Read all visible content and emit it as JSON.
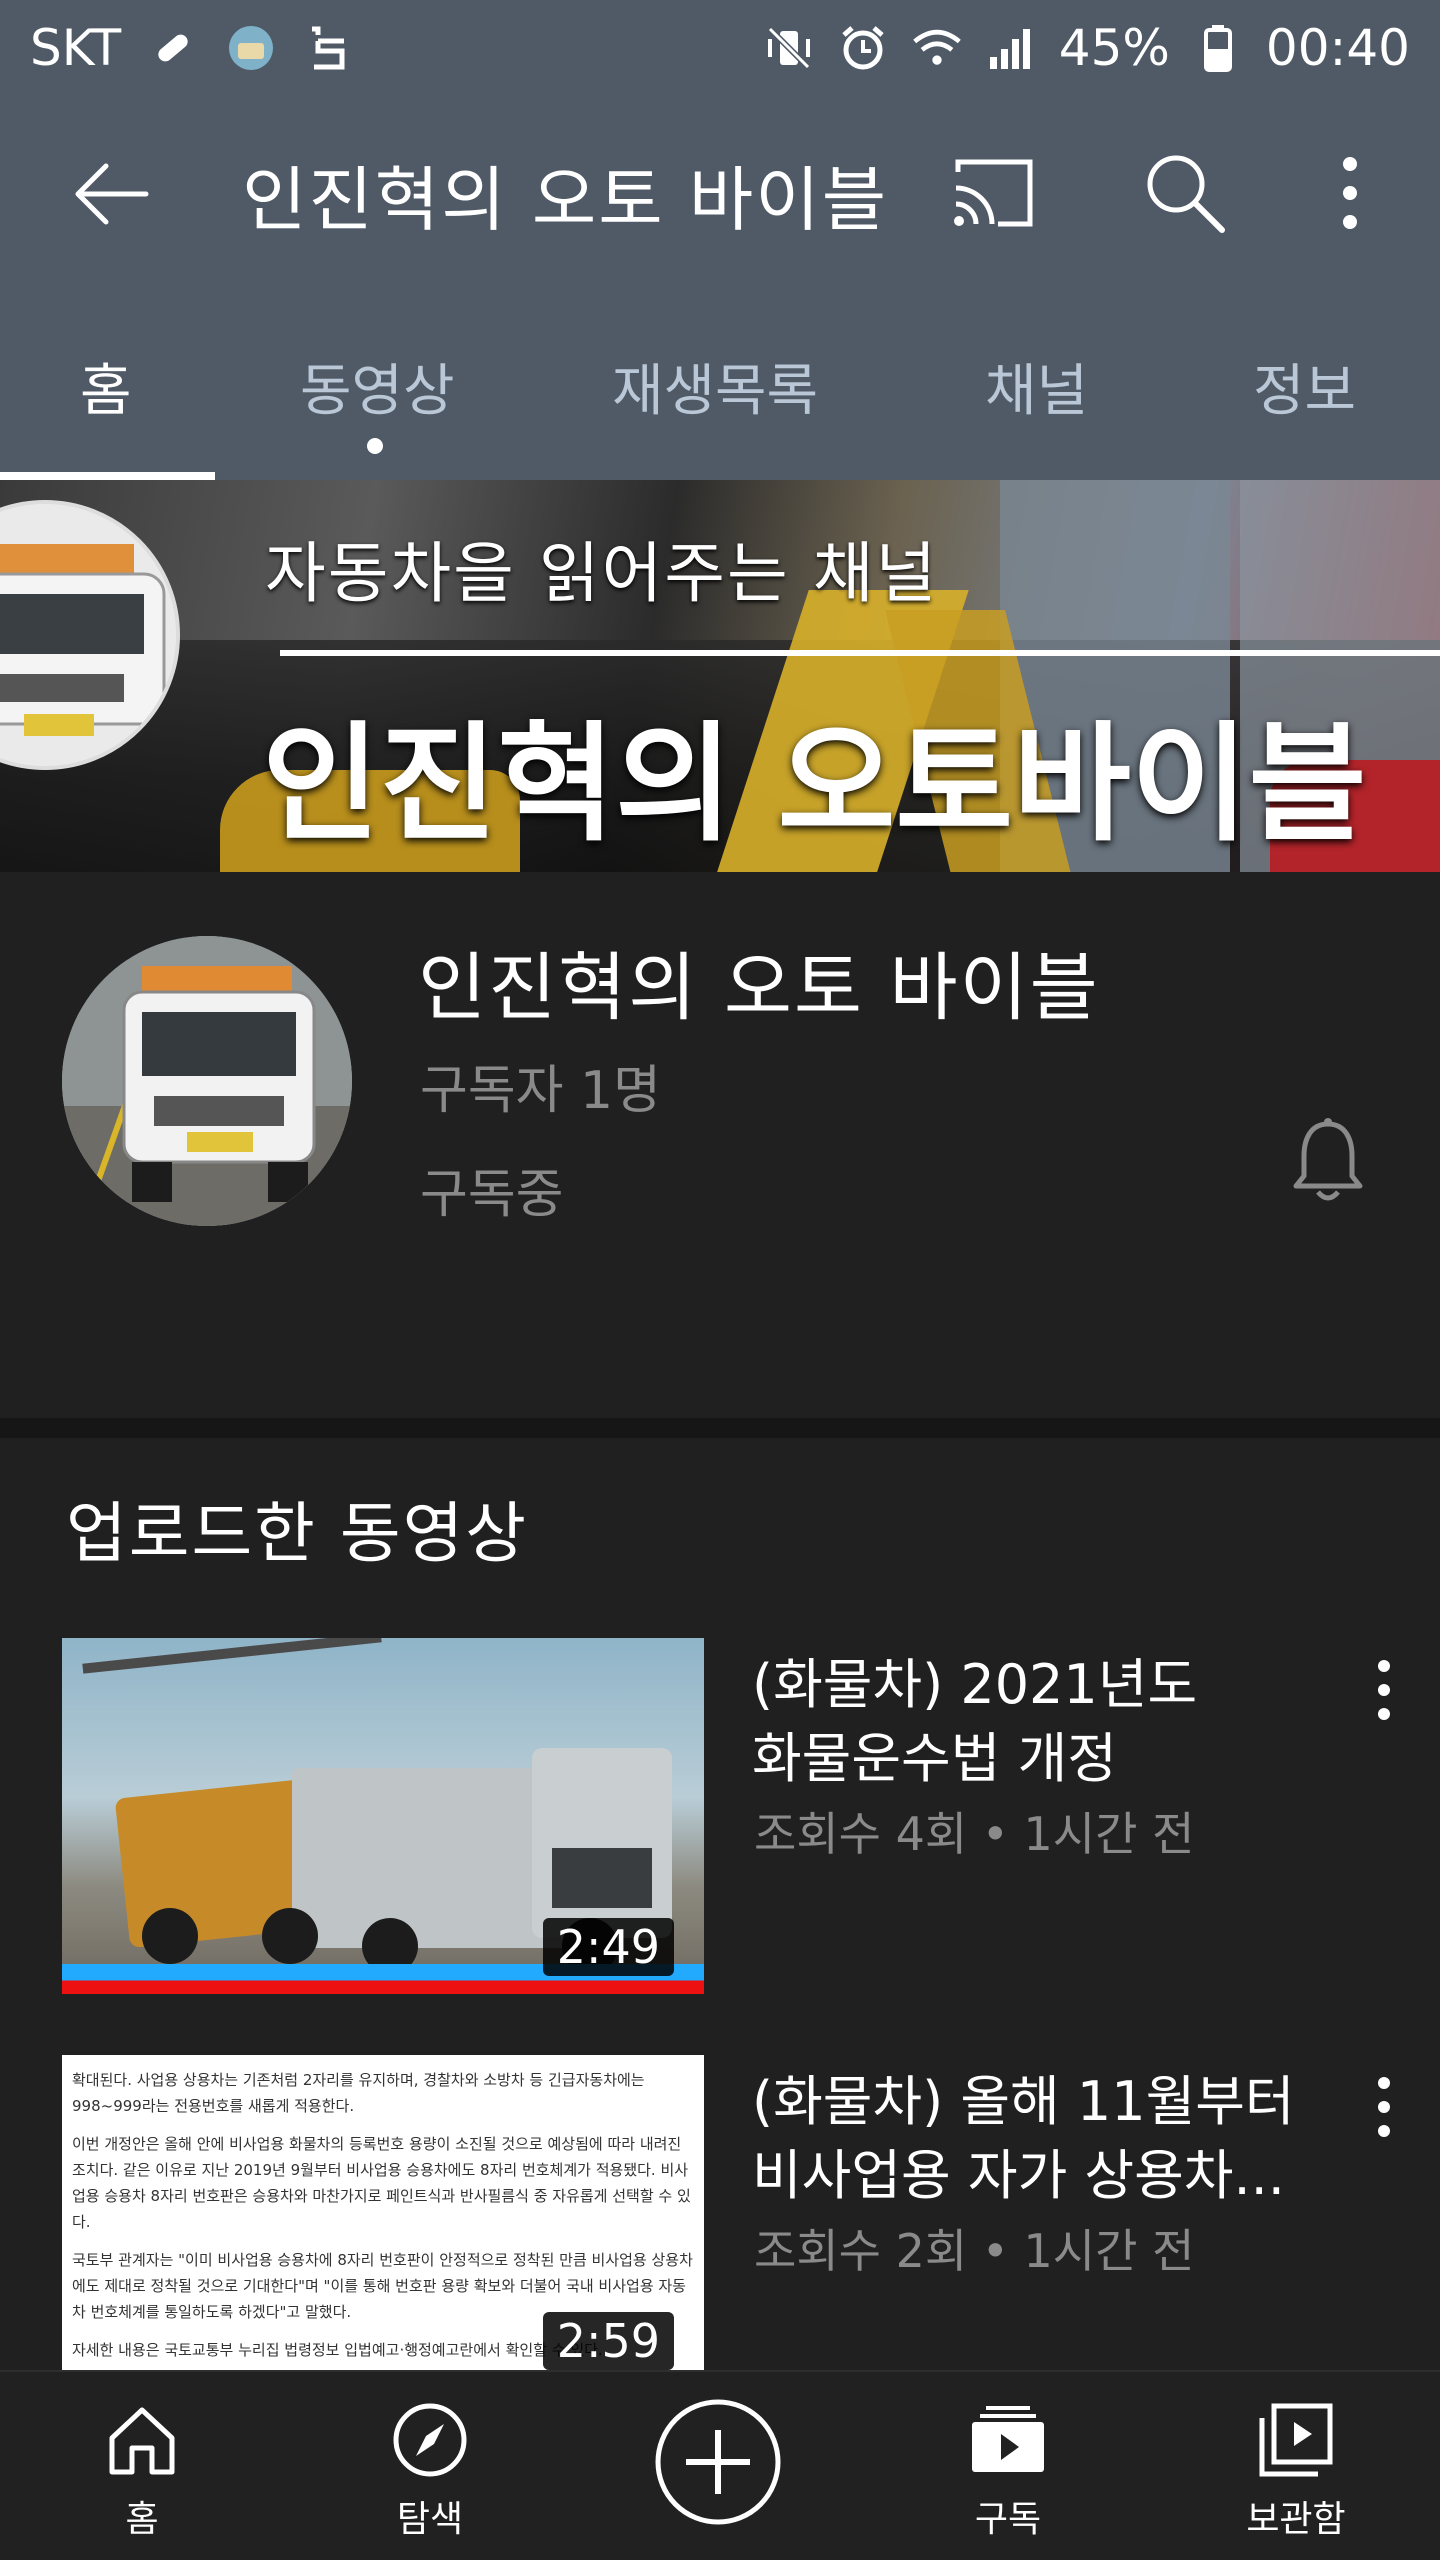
{
  "status_bar": {
    "carrier": "SKT",
    "battery": "45%",
    "time": "00:40"
  },
  "app_bar": {
    "title": "인진혁의 오토 바이블"
  },
  "tabs": [
    {
      "label": "홈",
      "active": true
    },
    {
      "label": "동영상",
      "active": false
    },
    {
      "label": "재생목록",
      "active": false
    },
    {
      "label": "채널",
      "active": false
    },
    {
      "label": "정보",
      "active": false
    }
  ],
  "banner": {
    "tagline": "자동차을  읽어주는 채널",
    "name": "인진혁의 오토바이블"
  },
  "channel": {
    "name": "인진혁의 오토 바이블",
    "subscribers": "구독자 1명",
    "status": "구독중"
  },
  "uploads": {
    "section_title": "업로드한 동영상",
    "videos": [
      {
        "title_line1": "(화물차) 2021년도",
        "title_line2": "화물운수법 개정",
        "meta": "조회수 4회 • 1시간 전",
        "duration": "2:49"
      },
      {
        "title_line1": "(화물차) 올해 11월부터",
        "title_line2": "비사업용 자가 상용차...",
        "meta": "조회수 2회 • 1시간 전",
        "duration": "2:59"
      }
    ]
  },
  "doc_thumbnail": {
    "p1": "확대된다. 사업용 상용차는 기존처럼 2자리를 유지하며, 경찰차와 소방차 등 긴급자동차에는 998~999라는 전용번호를 새롭게 적용한다.",
    "p2": "이번 개정안은 올해 안에 비사업용 화물차의 등록번호 용량이 소진될 것으로 예상됨에 따라 내려진 조치다. 같은 이유로 지난 2019년 9월부터 비사업용 승용차에도 8자리 번호체계가 적용됐다. 비사업용 승용차 8자리 번호판은 승용차와 마찬가지로 페인트식과 반사필름식 중 자유롭게 선택할 수 있다.",
    "p3": "국토부 관계자는 \"이미 비사업용 승용차에 8자리 번호판이 안정적으로 정착된 만큼 비사업용 상용차에도 제대로 정착될 것으로 기대한다\"며 \"이를 통해 번호판 용량 확보와 더불어 국내 비사업용 자동차 번호체계를 통일하도록 하겠다\"고 말했다.",
    "p4": "자세한 내용은 국토교통부 누리집 법령정보 입법예고·행정예고란에서 확인할 수 있다."
  },
  "bottom_nav": [
    {
      "label": "홈",
      "icon": "home-icon"
    },
    {
      "label": "탐색",
      "icon": "compass-icon"
    },
    {
      "label": "",
      "icon": "add-circle-icon"
    },
    {
      "label": "구독",
      "icon": "subscriptions-icon"
    },
    {
      "label": "보관함",
      "icon": "library-icon"
    }
  ],
  "colors": {
    "header_bg": "#4f5a66",
    "page_bg": "#202020",
    "inactive_tab": "#b9c7d6",
    "secondary_text": "#8a8a8a"
  }
}
